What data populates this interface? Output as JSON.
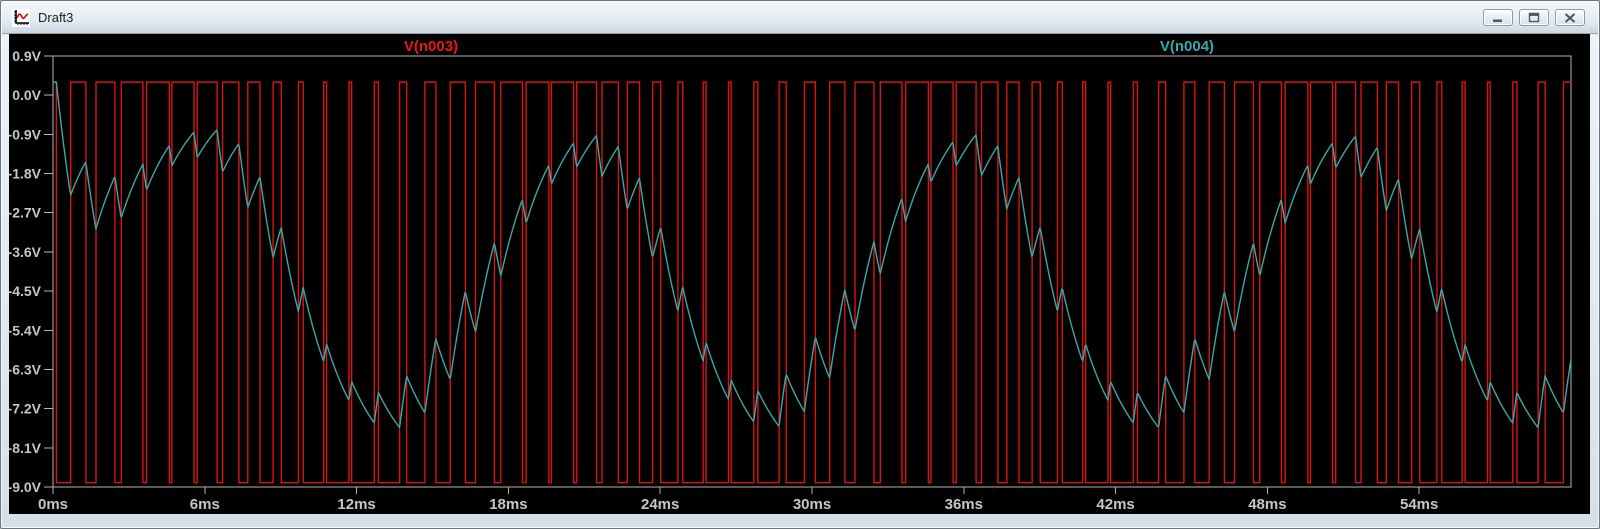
{
  "window": {
    "title": "Draft3",
    "icon": "waveform-plot-icon",
    "controls": [
      {
        "name": "minimize",
        "icon": "minimize-icon"
      },
      {
        "name": "restore",
        "icon": "restore-icon"
      },
      {
        "name": "close",
        "icon": "close-icon"
      }
    ]
  },
  "chart_data": {
    "type": "line",
    "title": "",
    "x_axis": {
      "unit": "ms",
      "min_ms": 0,
      "max_ms": 60,
      "major_tick_interval_ms": 6,
      "tick_labels": [
        "0ms",
        "6ms",
        "12ms",
        "18ms",
        "24ms",
        "30ms",
        "36ms",
        "42ms",
        "48ms",
        "54ms"
      ]
    },
    "y_axis": {
      "unit": "V",
      "min_v": -9.0,
      "max_v": 0.9,
      "tick_step_v": 0.9,
      "tick_labels": [
        "0.9V",
        "0.0V",
        "-0.9V",
        "-1.8V",
        "-2.7V",
        "-3.6V",
        "-4.5V",
        "-5.4V",
        "-6.3V",
        "-7.2V",
        "-8.1V",
        "-9.0V"
      ]
    },
    "grid": false,
    "background_color": "#000000",
    "axis_color": "#b4b4b4",
    "tick_label_color": "#c6c6c6",
    "legend": [
      {
        "label": "V(n003)",
        "color": "#ee1616",
        "x_fraction": 0.249
      },
      {
        "label": "V(n004)",
        "color": "#3aa8a8",
        "x_fraction": 0.747
      }
    ],
    "series": [
      {
        "name": "V(n003)",
        "color": "#d81414",
        "waveform": "pwm",
        "period_ms": 1.0,
        "cycle_start_offset_ms": -0.3,
        "v_high": 0.3,
        "v_low": -8.9,
        "duty_modulation": {
          "base": 0.5,
          "amplitude": 0.4,
          "period_ms": 15,
          "phase_ms": 0.1,
          "min": 0.08,
          "max": 0.92
        }
      },
      {
        "name": "V(n004)",
        "color": "#3aa8a8",
        "waveform": "rc_lowpass_of_pwm",
        "source": "V(n003)",
        "tau_ms": 1.7,
        "initial_v": 0.3,
        "observed_envelope": {
          "mean_v": -4.3,
          "amplitude_v": 3.2,
          "period_ms": 15,
          "ripple_vpp": 1.0
        }
      }
    ]
  }
}
